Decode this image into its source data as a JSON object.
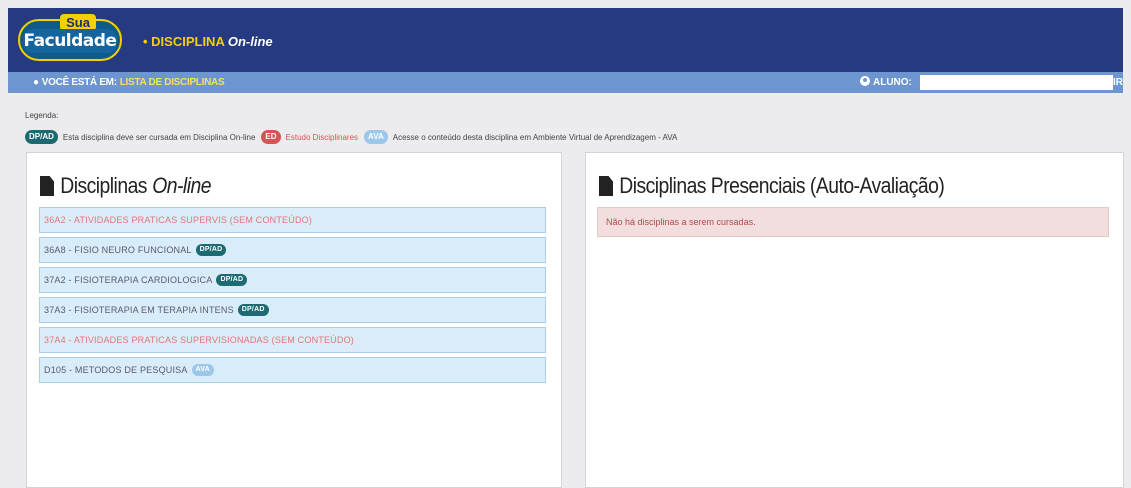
{
  "header": {
    "logo_top": "Sua",
    "logo_main": "Faculdade",
    "title_prefix": "• DISCIPLINA",
    "title_suffix": "On-line"
  },
  "subbar": {
    "location_label": "VOCÊ ESTÁ EM:",
    "location_link": "LISTA DE DISCIPLINAS",
    "aluno_label": "ALUNO:",
    "aluno_value": "",
    "aluno_end": "IR"
  },
  "legend": {
    "title": "Legenda:",
    "items": [
      {
        "badge": "DP/AD",
        "text": "Esta disciplina deve ser cursada em Disciplina On-line"
      },
      {
        "badge": "ED",
        "text": "Estudo Disciplinares"
      },
      {
        "badge": "AVA",
        "text": "Acesse o conteúdo desta disciplina em Ambiente Virtual de Aprendizagem - AVA"
      }
    ]
  },
  "online_panel": {
    "title": "Disciplinas",
    "title_em": "On-line",
    "items": [
      {
        "label": "36A2 - ATIVIDADES PRATICAS SUPERVIS (SEM CONTEÚDO)",
        "badge": ""
      },
      {
        "label": "36A8 - FISIO NEURO FUNCIONAL",
        "badge": "DP/AD"
      },
      {
        "label": "37A2 - FISIOTERAPIA CARDIOLOGICA",
        "badge": "DP/AD"
      },
      {
        "label": "37A3 - FISIOTERAPIA EM TERAPIA INTENS",
        "badge": "DP/AD"
      },
      {
        "label": "37A4 - ATIVIDADES PRATICAS SUPERVISIONADAS (SEM CONTEÚDO)",
        "badge": ""
      },
      {
        "label": "D105 - METODOS DE PESQUISA",
        "badge": "AVA"
      }
    ]
  },
  "presencial_panel": {
    "title": "Disciplinas Presenciais (Auto-Avaliação)",
    "message": "Não há disciplinas a serem cursadas."
  },
  "colors": {
    "header_bg": "#263a82",
    "subbar_bg": "#6d95cf",
    "accent_yellow": "#f4d000",
    "badge_teal": "#1d6a72",
    "badge_red": "#d85353",
    "badge_light": "#9bc7ea"
  },
  "icons": [
    "map-pin-icon",
    "user-circle-icon",
    "document-icon"
  ]
}
